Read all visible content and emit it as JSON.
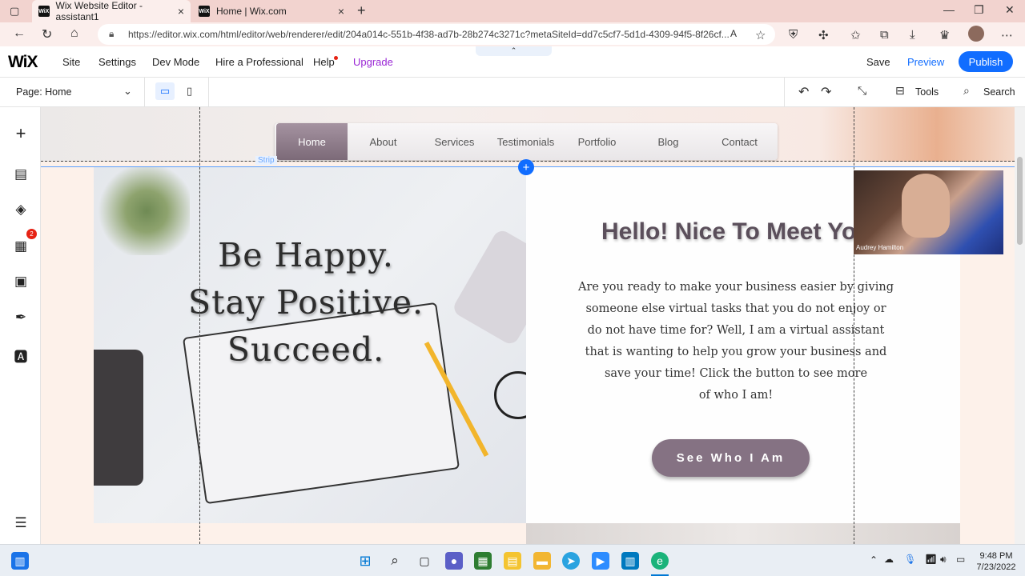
{
  "browser": {
    "tabs": [
      {
        "title": "Wix Website Editor - assistant1",
        "favicon": "WiX"
      },
      {
        "title": "Home | Wix.com",
        "favicon": "WiX"
      }
    ],
    "url": "https://editor.wix.com/html/editor/web/renderer/edit/204a014c-551b-4f38-ad7b-28b274c3271c?metaSiteId=dd7c5cf7-5d1d-4309-94f5-8f26cf..."
  },
  "wix": {
    "logo": "WiX",
    "menu": [
      "Site",
      "Settings",
      "Dev Mode",
      "Hire a Professional",
      "Help",
      "Upgrade"
    ],
    "save": "Save",
    "preview": "Preview",
    "publish": "Publish",
    "page_label": "Page: Home",
    "tools": "Tools",
    "search": "Search",
    "apps_badge": "2"
  },
  "site": {
    "nav": [
      "Home",
      "About",
      "Services",
      "Testimonials",
      "Portfolio",
      "Blog",
      "Contact"
    ],
    "strip_label": "Strip",
    "quote": [
      "Be Happy.",
      "Stay Positive.",
      "Succeed."
    ],
    "heading": "Hello! Nice To Meet You",
    "paragraph": [
      "Are you ready to make your business easier by giving",
      "someone else virtual tasks that you do not enjoy or",
      "do not have time for? Well, I am a virtual assistant",
      "that is wanting to help you grow your business and",
      "save your time! Click the button to see more",
      "of who I am!"
    ],
    "button": "See Who I Am"
  },
  "video": {
    "name": "Audrey Hamilton"
  },
  "taskbar": {
    "time": "9:48 PM",
    "date": "7/23/2022"
  }
}
